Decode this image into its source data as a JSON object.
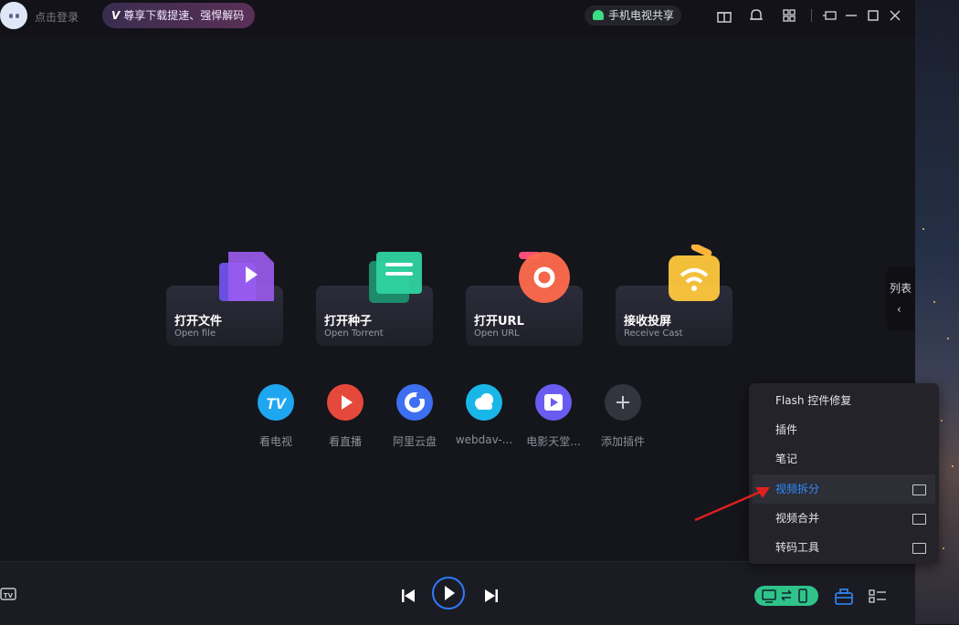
{
  "topbar": {
    "login_text": "点击登录",
    "vip_text": "尊享下载提速、强悍解码",
    "vip_mark": "V",
    "share_text": "手机电视共享"
  },
  "tiles": [
    {
      "title": "打开文件",
      "subtitle": "Open file",
      "icon": "file-play-icon"
    },
    {
      "title": "打开种子",
      "subtitle": "Open Torrent",
      "icon": "torrent-icon"
    },
    {
      "title": "打开URL",
      "subtitle": "Open URL",
      "icon": "url-icon"
    },
    {
      "title": "接收投屏",
      "subtitle": "Receive Cast",
      "icon": "cast-icon"
    }
  ],
  "plugins": [
    {
      "label": "看电视",
      "icon": "tv-icon",
      "color": "#1ea7f0",
      "glyph": "TV"
    },
    {
      "label": "看直播",
      "icon": "live-icon",
      "color": "#e5493b",
      "glyph": "▶"
    },
    {
      "label": "阿里云盘",
      "icon": "aliyun-drive-icon",
      "color": "#3d6ff0",
      "glyph": "◔"
    },
    {
      "label": "webdav-...",
      "icon": "webdav-icon",
      "color": "#19b7e8",
      "glyph": "☁"
    },
    {
      "label": "电影天堂...",
      "icon": "movie-heaven-icon",
      "color": "#6a5cf0",
      "glyph": "▶"
    },
    {
      "label": "添加插件",
      "icon": "add-plugin-icon",
      "color": "#34343e",
      "glyph": "+"
    }
  ],
  "list_tab": {
    "label": "列表"
  },
  "menu": {
    "items": [
      {
        "label": "Flash 控件修复",
        "folder": false,
        "highlighted": false
      },
      {
        "label": "插件",
        "folder": false,
        "highlighted": false
      },
      {
        "label": "笔记",
        "folder": false,
        "highlighted": false
      },
      {
        "label": "视频拆分",
        "folder": true,
        "highlighted": true
      },
      {
        "label": "视频合并",
        "folder": true,
        "highlighted": false
      },
      {
        "label": "转码工具",
        "folder": true,
        "highlighted": false
      }
    ]
  },
  "colors": {
    "accent": "#2f7bff",
    "toggle": "#2fc38a",
    "annotation_arrow": "#e01f1f"
  }
}
